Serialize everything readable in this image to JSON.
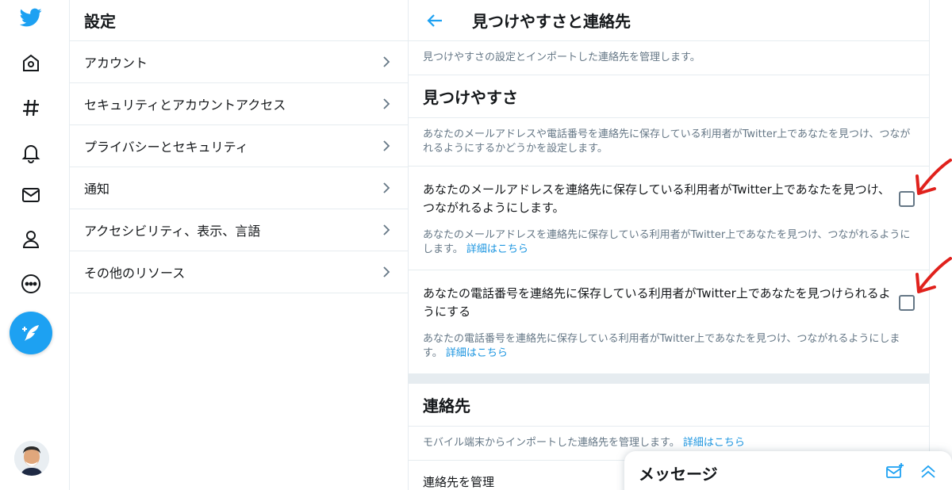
{
  "settings": {
    "title": "設定",
    "items": [
      {
        "label": "アカウント"
      },
      {
        "label": "セキュリティとアカウントアクセス"
      },
      {
        "label": "プライバシーとセキュリティ"
      },
      {
        "label": "通知"
      },
      {
        "label": "アクセシビリティ、表示、言語"
      },
      {
        "label": "その他のリソース"
      }
    ]
  },
  "detail": {
    "title": "見つけやすさと連絡先",
    "description": "見つけやすさの設定とインポートした連絡先を管理します。",
    "discoverability": {
      "title": "見つけやすさ",
      "description": "あなたのメールアドレスや電話番号を連絡先に保存している利用者がTwitter上であなたを見つけ、つながれるようにするかどうかを設定します。",
      "options": [
        {
          "label": "あなたのメールアドレスを連絡先に保存している利用者がTwitter上であなたを見つけ、つながれるようにします。",
          "help": "あなたのメールアドレスを連絡先に保存している利用者がTwitter上であなたを見つけ、つながれるようにします。",
          "link": "詳細はこちら",
          "checked": false
        },
        {
          "label": "あなたの電話番号を連絡先に保存している利用者がTwitter上であなたを見つけられるようにする",
          "help": "あなたの電話番号を連絡先に保存している利用者がTwitter上であなたを見つけ、つながれるようにします。",
          "link": "詳細はこちら",
          "checked": false
        }
      ]
    },
    "contacts": {
      "title": "連絡先",
      "description": "モバイル端末からインポートした連絡先を管理します。",
      "link": "詳細はこちら",
      "manage_label": "連絡先を管理"
    }
  },
  "messages": {
    "title": "メッセージ"
  },
  "colors": {
    "accent": "#1da1f2",
    "annotation": "#e0211c"
  }
}
